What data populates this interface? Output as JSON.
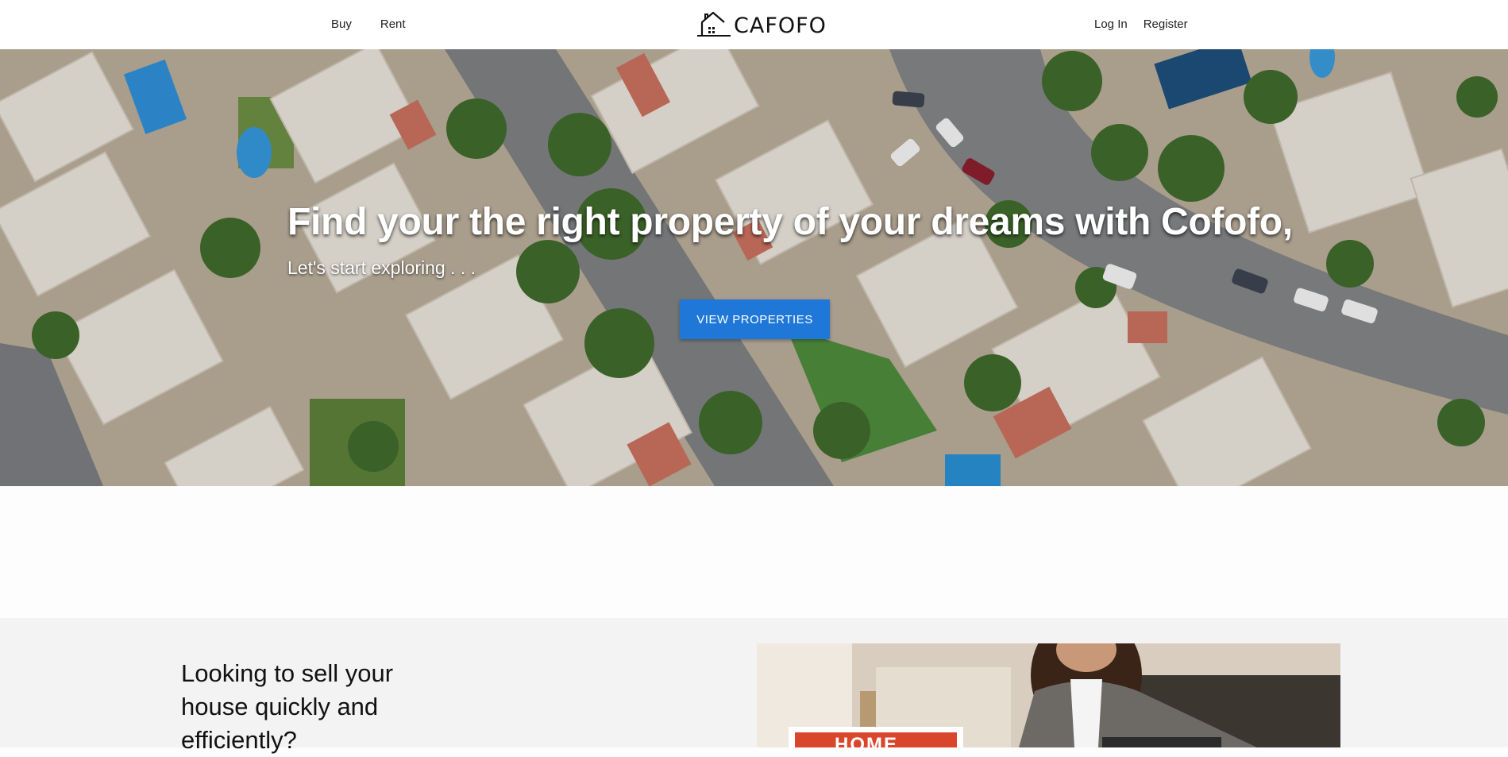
{
  "header": {
    "nav_left": [
      "Buy",
      "Rent"
    ],
    "logo_text": "CAFOFO",
    "nav_right": [
      "Log In",
      "Register"
    ]
  },
  "hero": {
    "title": "Find your the right property of your dreams with Cofofo,",
    "subtitle": "Let's start exploring . . .",
    "button_label": "VIEW PROPERTIES"
  },
  "sell": {
    "heading": "Looking to sell your house quickly and efficiently?",
    "sign_text": "HOME"
  },
  "colors": {
    "accent": "#1f78d8",
    "section_bg": "#f3f3f3"
  },
  "icons": {
    "logo": "house-icon"
  }
}
